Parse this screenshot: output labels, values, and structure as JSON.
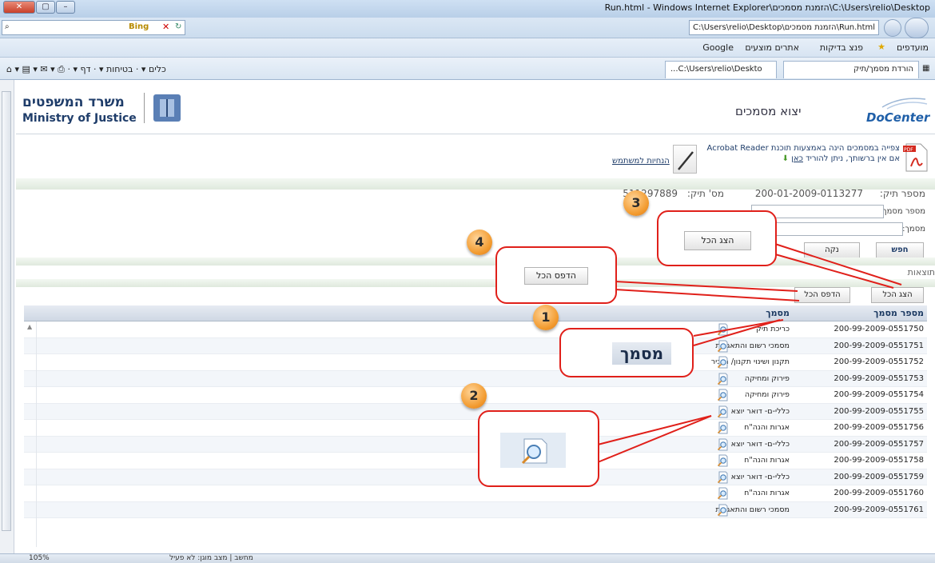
{
  "browser": {
    "title": "Run.html - Windows Internet Explorer\\הזמנת מסמכים\\C:\\Users\\relio\\Desktop",
    "address": "C:\\Users\\relio\\Desktop\\הזמנת מסמכים\\Run.html",
    "search_engine": "Bing",
    "favorites_label": "מועדפים",
    "fav_items": [
      "פנצ בדיקות",
      "אתרים מוצעים",
      "Google"
    ],
    "tabs": [
      "הורדת מסמך/תיק",
      "...C:\\Users\\relio\\Deskto"
    ],
    "toolbar": [
      "כלים",
      "בטיחות",
      "דף"
    ],
    "zoom": "105%",
    "status_text": "מחשב | מצב מוגן: לא פעיל"
  },
  "header": {
    "ministry_he": "משרד המשפטים",
    "ministry_en": "Ministry of Justice",
    "page_title": "יצוא מסמכים",
    "logo_text": "DoCenter"
  },
  "acrobat": {
    "line1": "צפייה במסמכים הינה באמצעות תוכנת Acrobat Reader",
    "line2": "אם אין ברשותך, ניתן להוריד",
    "link": "כאן",
    "guide_link": "הנחיות למשתמש"
  },
  "case": {
    "case_label": "מספר תיק:",
    "case_number": "200-01-2009-0113277",
    "file_label": "מס' תיק:",
    "file_number": "511297889"
  },
  "form": {
    "doc_number_label": "מספר מסמך:",
    "doc_label": "מסמך:",
    "search_button": "חפש",
    "clear_button": "נקה",
    "results_label": "תוצאות חיפוש...",
    "show_all_button": "הצג הכל",
    "print_all_button": "הדפס הכל"
  },
  "table": {
    "columns": [
      "מספר מסמך",
      "מסמך"
    ],
    "rows": [
      {
        "number": "200-99-2009-0551750",
        "doc": "כריכת תיק"
      },
      {
        "number": "200-99-2009-0551751",
        "doc": "מסמכי רשום והתאגדות"
      },
      {
        "number": "200-99-2009-0551752",
        "doc": "תקנון ושינוי תקנון/ תזכיר"
      },
      {
        "number": "200-99-2009-0551753",
        "doc": "פירוק ומחיקה"
      },
      {
        "number": "200-99-2009-0551754",
        "doc": "פירוק ומחיקה"
      },
      {
        "number": "200-99-2009-0551755",
        "doc": "כללי-ם- דואר יוצא"
      },
      {
        "number": "200-99-2009-0551756",
        "doc": "אגרות והנה\"ח"
      },
      {
        "number": "200-99-2009-0551757",
        "doc": "כללי-ם- דואר יוצא"
      },
      {
        "number": "200-99-2009-0551758",
        "doc": "אגרות והנה\"ח"
      },
      {
        "number": "200-99-2009-0551759",
        "doc": "כללי-ם- דואר יוצא"
      },
      {
        "number": "200-99-2009-0551760",
        "doc": "אגרות והנה\"ח"
      },
      {
        "number": "200-99-2009-0551761",
        "doc": "מסמכי רשום והתאגדות"
      }
    ]
  },
  "callouts": {
    "badge1": "1",
    "badge2": "2",
    "badge3": "3",
    "badge4": "4",
    "doc_zoom_label": "מסמך",
    "show_all_zoom": "הצג הכל",
    "print_all_zoom": "הדפס הכל"
  },
  "colors": {
    "callout": "#e0201a",
    "badge": "#f29a2e",
    "header_text": "#1f3d6a"
  }
}
